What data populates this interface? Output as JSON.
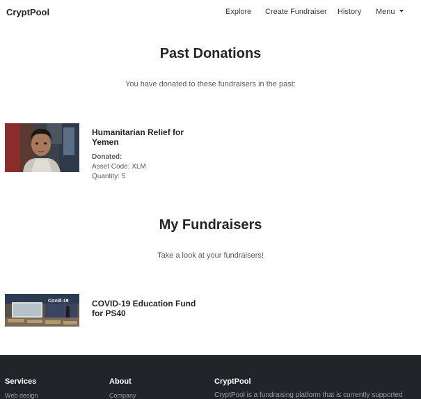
{
  "navbar": {
    "brand": "CryptPool",
    "links": [
      "Explore",
      "Create Fundraiser",
      "History"
    ],
    "menu_label": "Menu"
  },
  "past_donations": {
    "title": "Past Donations",
    "subtitle": "You have donated to these fundraisers in the past:",
    "items": [
      {
        "title": "Humanitarian Relief for Yemen",
        "donated_label": "Donated:",
        "asset_code": "Asset Code: XLM",
        "quantity": "Quantity: 5"
      }
    ]
  },
  "my_fundraisers": {
    "title": "My Fundraisers",
    "subtitle": "Take a look at your fundraisers!",
    "items": [
      {
        "title": "COVID-19 Education Fund for PS40",
        "image_caption": "Covid-19"
      }
    ]
  },
  "footer": {
    "services": {
      "heading": "Services",
      "first_link": "Web design"
    },
    "about": {
      "heading": "About",
      "first_link": "Company"
    },
    "cryptpool": {
      "heading": "CryptPool",
      "text": "CryptPool is a fundraising platform that is currently supported"
    }
  }
}
